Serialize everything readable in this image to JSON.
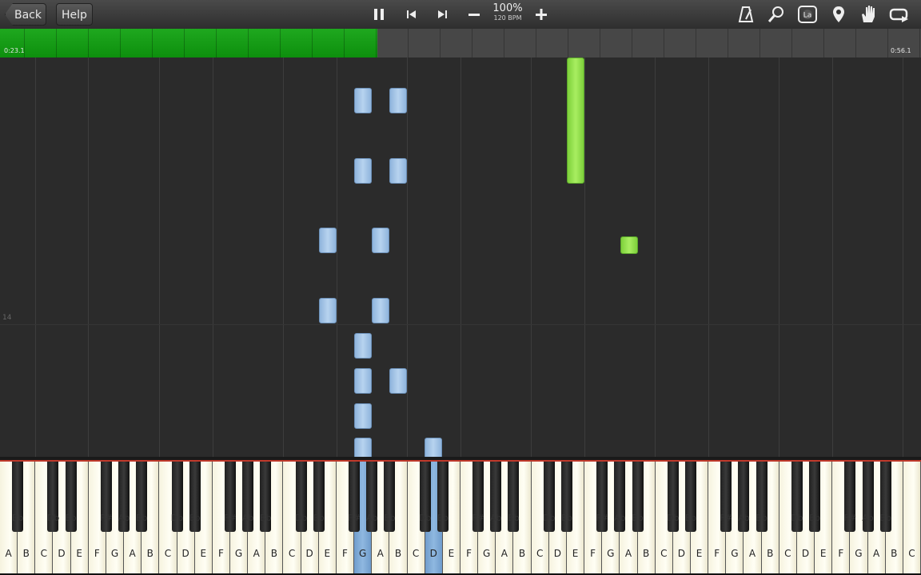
{
  "toolbar": {
    "back_label": "Back",
    "help_label": "Help",
    "speed_percent": "100%",
    "tempo_bpm": "120 BPM",
    "icons": [
      "pause-icon",
      "previous-icon",
      "next-icon",
      "minus-icon",
      "plus-icon",
      "metronome-icon",
      "search-icon",
      "note-label-icon",
      "marker-icon",
      "hand-icon",
      "loop-icon"
    ],
    "note_label_badge": "La"
  },
  "timeline": {
    "current_time": "0:23.1",
    "total_time": "0:56.1",
    "progress_fraction": 0.41
  },
  "roll": {
    "measure_number": "14"
  },
  "keyboard": {
    "white_keys": [
      "A",
      "B",
      "C",
      "D",
      "E",
      "F",
      "G",
      "A",
      "B",
      "C",
      "D",
      "E",
      "F",
      "G",
      "A",
      "B",
      "C",
      "D",
      "E",
      "F",
      "G",
      "A",
      "B",
      "C",
      "D",
      "E",
      "F",
      "G",
      "A",
      "B",
      "C",
      "D",
      "E",
      "F",
      "G",
      "A",
      "B",
      "C",
      "D",
      "E",
      "F",
      "G",
      "A",
      "B",
      "C",
      "D",
      "E",
      "F",
      "G",
      "A",
      "B",
      "C"
    ],
    "black_keys": [
      "Bb",
      "Db",
      "Eb",
      "F#",
      "Ab",
      "Bb",
      "Db",
      "Eb",
      "F#",
      "Ab",
      "Bb",
      "Db",
      "Eb",
      "F#",
      "Ab",
      "Bb",
      "Db",
      "Eb",
      "F#",
      "Ab",
      "Bb",
      "Db",
      "Eb",
      "F#",
      "Ab",
      "Bb",
      "Db",
      "Eb",
      "F#",
      "Ab",
      "Bb",
      "Db",
      "Eb",
      "F#",
      "Ab",
      "Bb"
    ],
    "pressed_keys": [
      "G",
      "D"
    ]
  },
  "colors": {
    "progress_green": "#13a013",
    "left_hand_note": "#a9c8ea",
    "right_hand_note": "#92e04b",
    "divider_red": "#c0392b"
  }
}
